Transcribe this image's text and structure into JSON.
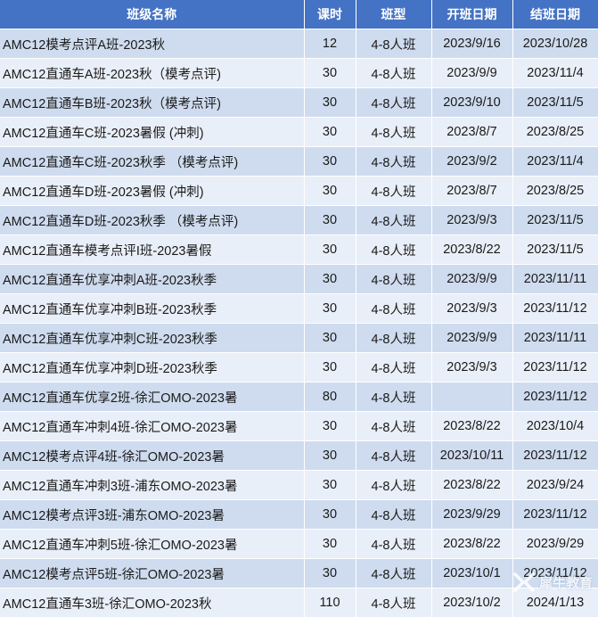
{
  "headers": {
    "name": "班级名称",
    "hours": "课时",
    "type": "班型",
    "start": "开班日期",
    "end": "结班日期"
  },
  "rows": [
    {
      "name": "AMC12模考点评A班-2023秋",
      "hours": "12",
      "type": "4-8人班",
      "start": "2023/9/16",
      "end": "2023/10/28"
    },
    {
      "name": "AMC12直通车A班-2023秋（模考点评)",
      "hours": "30",
      "type": "4-8人班",
      "start": "2023/9/9",
      "end": "2023/11/4"
    },
    {
      "name": "AMC12直通车B班-2023秋（模考点评)",
      "hours": "30",
      "type": "4-8人班",
      "start": "2023/9/10",
      "end": "2023/11/5"
    },
    {
      "name": "AMC12直通车C班-2023暑假 (冲刺)",
      "hours": "30",
      "type": "4-8人班",
      "start": "2023/8/7",
      "end": "2023/8/25"
    },
    {
      "name": "AMC12直通车C班-2023秋季 （模考点评)",
      "hours": "30",
      "type": "4-8人班",
      "start": "2023/9/2",
      "end": "2023/11/4"
    },
    {
      "name": "AMC12直通车D班-2023暑假 (冲刺)",
      "hours": "30",
      "type": "4-8人班",
      "start": "2023/8/7",
      "end": "2023/8/25"
    },
    {
      "name": "AMC12直通车D班-2023秋季 （模考点评)",
      "hours": "30",
      "type": "4-8人班",
      "start": "2023/9/3",
      "end": "2023/11/5"
    },
    {
      "name": "AMC12直通车模考点评I班-2023暑假",
      "hours": "30",
      "type": "4-8人班",
      "start": "2023/8/22",
      "end": "2023/11/5"
    },
    {
      "name": "AMC12直通车优享冲刺A班-2023秋季",
      "hours": "30",
      "type": "4-8人班",
      "start": "2023/9/9",
      "end": "2023/11/11"
    },
    {
      "name": "AMC12直通车优享冲刺B班-2023秋季",
      "hours": "30",
      "type": "4-8人班",
      "start": "2023/9/3",
      "end": "2023/11/12"
    },
    {
      "name": "AMC12直通车优享冲刺C班-2023秋季",
      "hours": "30",
      "type": "4-8人班",
      "start": "2023/9/9",
      "end": "2023/11/11"
    },
    {
      "name": "AMC12直通车优享冲刺D班-2023秋季",
      "hours": "30",
      "type": "4-8人班",
      "start": "2023/9/3",
      "end": "2023/11/12"
    },
    {
      "name": "AMC12直通车优享2班-徐汇OMO-2023暑",
      "hours": "80",
      "type": "4-8人班",
      "start": "",
      "end": "2023/11/12"
    },
    {
      "name": "AMC12直通车冲刺4班-徐汇OMO-2023暑",
      "hours": "30",
      "type": "4-8人班",
      "start": "2023/8/22",
      "end": "2023/10/4"
    },
    {
      "name": "AMC12模考点评4班-徐汇OMO-2023暑",
      "hours": "30",
      "type": "4-8人班",
      "start": "2023/10/11",
      "end": "2023/11/12"
    },
    {
      "name": "AMC12直通车冲刺3班-浦东OMO-2023暑",
      "hours": "30",
      "type": "4-8人班",
      "start": "2023/8/22",
      "end": "2023/9/24"
    },
    {
      "name": "AMC12模考点评3班-浦东OMO-2023暑",
      "hours": "30",
      "type": "4-8人班",
      "start": "2023/9/29",
      "end": "2023/11/12"
    },
    {
      "name": "AMC12直通车冲刺5班-徐汇OMO-2023暑",
      "hours": "30",
      "type": "4-8人班",
      "start": "2023/8/22",
      "end": "2023/9/29"
    },
    {
      "name": "AMC12模考点评5班-徐汇OMO-2023暑",
      "hours": "30",
      "type": "4-8人班",
      "start": "2023/10/1",
      "end": "2023/11/12"
    },
    {
      "name": "AMC12直通车3班-徐汇OMO-2023秋",
      "hours": "110",
      "type": "4-8人班",
      "start": "2023/10/2",
      "end": "2024/1/13"
    }
  ],
  "watermark": {
    "text": "犀牛教育",
    "icon": "rhino-logo-icon",
    "color": "#ffffff"
  },
  "colors": {
    "header_bg": "#4472c4",
    "row_odd": "#cfdcef",
    "row_even": "#e9eff8"
  }
}
